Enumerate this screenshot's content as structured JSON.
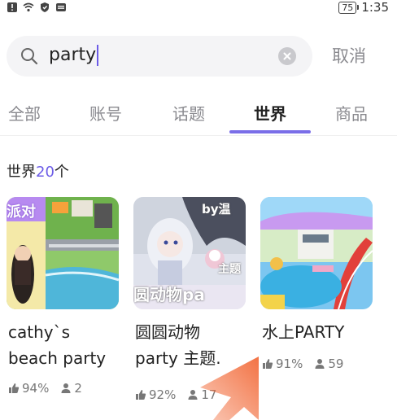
{
  "status_bar": {
    "battery": "75",
    "time": "1:35"
  },
  "search": {
    "query": "party",
    "cancel_label": "取消"
  },
  "tabs": [
    {
      "label": "全部"
    },
    {
      "label": "账号"
    },
    {
      "label": "话题"
    },
    {
      "label": "世界"
    },
    {
      "label": "商品"
    }
  ],
  "section": {
    "title_prefix": "世界",
    "count": "20",
    "title_suffix": "个"
  },
  "cards": [
    {
      "title_line1": "cathy`s",
      "title_line2": "beach party",
      "thumb_text": "派对",
      "likes": "94%",
      "players": "2"
    },
    {
      "title_line1": "圆圆动物",
      "title_line2": "party 主题.",
      "thumb_text": "圆动物pa",
      "thumb_text2": "by温",
      "thumb_text3": "主题",
      "likes": "92%",
      "players": "17"
    },
    {
      "title_line1": "水上PARTY",
      "title_line2": "",
      "likes": "91%",
      "players": "59"
    }
  ],
  "colors": {
    "accent": "#7a6ee8",
    "overlay_arrow": "#f26b3a"
  },
  "icons": {
    "search": "search-icon",
    "clear": "clear-icon",
    "like": "thumbs-up-icon",
    "players": "person-icon"
  }
}
